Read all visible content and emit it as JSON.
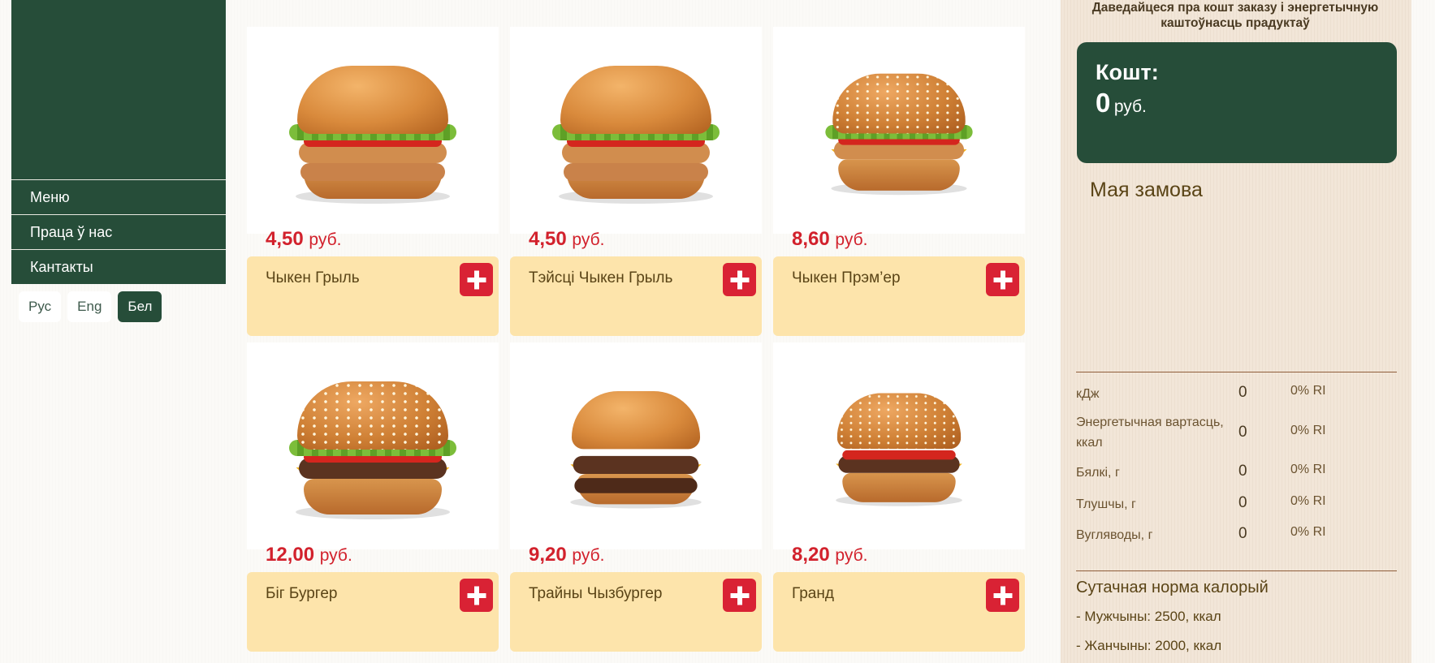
{
  "sidebar": {
    "nav": [
      "Меню",
      "Праца ў нас",
      "Кантакты"
    ],
    "languages": [
      "Рус",
      "Eng",
      "Бел"
    ],
    "active_language": "Бел"
  },
  "products": [
    {
      "price": "4,50",
      "currency": "руб.",
      "name": "Чыкен Грыль"
    },
    {
      "price": "4,50",
      "currency": "руб.",
      "name": "Тэйсці Чыкен Грыль"
    },
    {
      "price": "8,60",
      "currency": "руб.",
      "name": "Чыкен Прэм’ер"
    },
    {
      "price": "12,00",
      "currency": "руб.",
      "name": "Біг Бургер"
    },
    {
      "price": "9,20",
      "currency": "руб.",
      "name": "Трайны Чызбургер"
    },
    {
      "price": "8,20",
      "currency": "руб.",
      "name": "Гранд"
    }
  ],
  "panel": {
    "intro": "Даведайцеся пра кошт заказу і энергетычную каштоўнасць прадуктаў",
    "cost_title": "Кошт:",
    "cost_value": "0",
    "cost_currency": "руб.",
    "order_title": "Мая замова",
    "nutrition": [
      {
        "label": "кДж",
        "value": "0",
        "ri": "0% RI"
      },
      {
        "label": "Энергетычная вартасць, ккал",
        "value": "0",
        "ri": "0% RI"
      },
      {
        "label": "Бялкі, г",
        "value": "0",
        "ri": "0% RI"
      },
      {
        "label": "Тлушчы, г",
        "value": "0",
        "ri": "0% RI"
      },
      {
        "label": "Вугляводы, г",
        "value": "0",
        "ri": "0% RI"
      }
    ],
    "daily_title": "Сутачная норма калорый",
    "daily": [
      "- Мужчыны: 2500, ккал",
      "- Жанчыны: 2000, ккал"
    ]
  },
  "colors": {
    "brand_green": "#264d39",
    "price_red": "#d2212c",
    "card_yellow": "#fde4ab",
    "add_red": "#d92234"
  }
}
